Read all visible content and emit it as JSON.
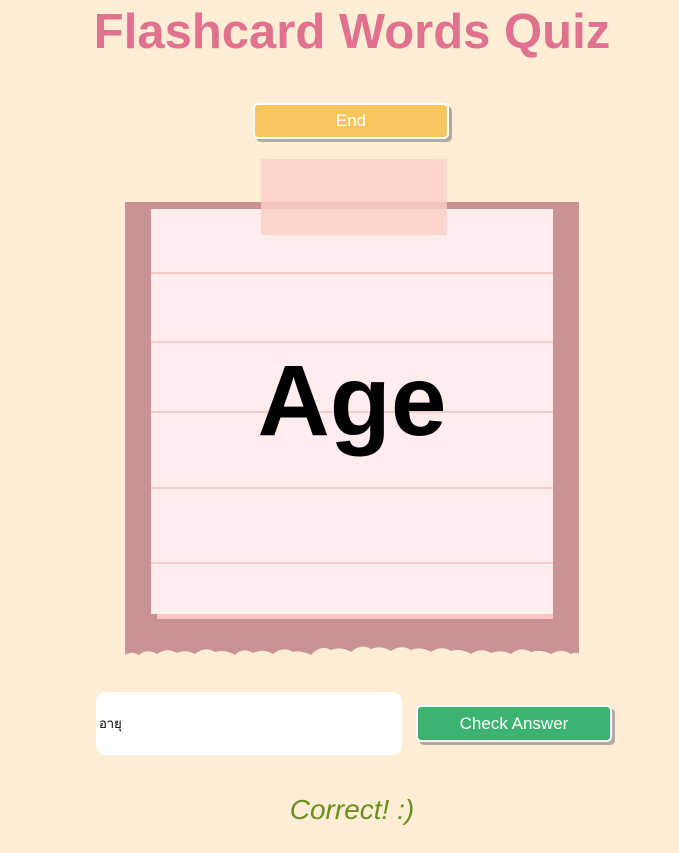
{
  "app": {
    "title": "Flashcard Words Quiz"
  },
  "controls": {
    "end_label": "End",
    "check_label": "Check Answer"
  },
  "card": {
    "word": "Age"
  },
  "answer": {
    "value": "อายุ",
    "placeholder": ""
  },
  "feedback": {
    "text": "Correct! :)"
  },
  "colors": {
    "background": "#ffeed5",
    "title": "#e0728f",
    "end_button": "#f8c65f",
    "check_button": "#3cb371",
    "card_back": "#c99393",
    "card_paper": "#ffecec",
    "tape": "#fccfc7",
    "feedback": "#6b8e23"
  }
}
